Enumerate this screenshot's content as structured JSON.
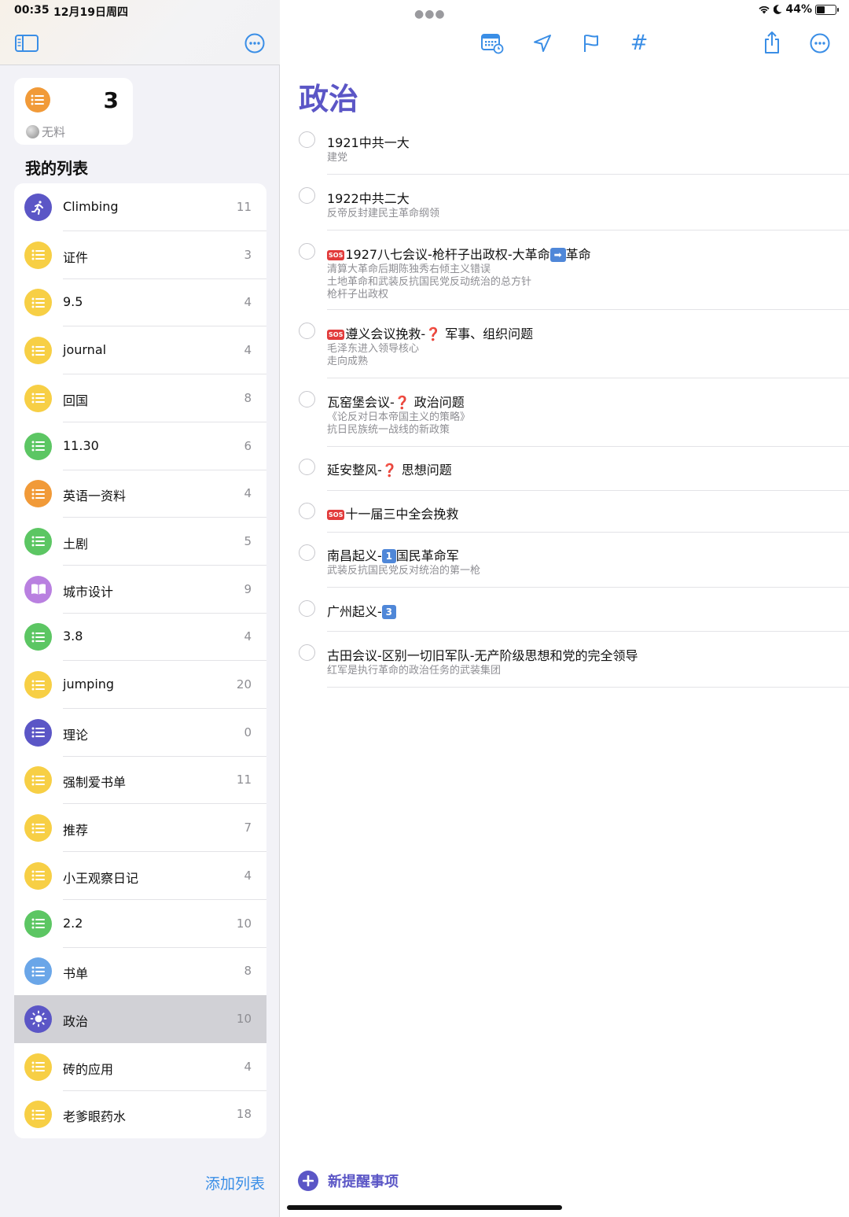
{
  "status": {
    "time": "00:35",
    "date": "12月19日周四",
    "battery": "44%",
    "battery_level": 0.44
  },
  "smart_card": {
    "count": "3",
    "label": "无料"
  },
  "my_lists_title": "我的列表",
  "lists": [
    {
      "name": "Climbing",
      "count": "11",
      "color": "#5b56c6",
      "icon": "running-person-icon"
    },
    {
      "name": "证件",
      "count": "3",
      "color": "#f7cf45",
      "icon": "list-icon"
    },
    {
      "name": "9.5",
      "count": "4",
      "color": "#f7cf45",
      "icon": "list-icon"
    },
    {
      "name": "journal",
      "count": "4",
      "color": "#f7cf45",
      "icon": "list-icon"
    },
    {
      "name": "回国",
      "count": "8",
      "color": "#f7cf45",
      "icon": "list-icon"
    },
    {
      "name": "11.30",
      "count": "6",
      "color": "#5cc663",
      "icon": "list-icon"
    },
    {
      "name": "英语一资料",
      "count": "4",
      "color": "#f19a38",
      "icon": "list-icon"
    },
    {
      "name": "土剧",
      "count": "5",
      "color": "#5cc663",
      "icon": "list-icon"
    },
    {
      "name": "城市设计",
      "count": "9",
      "color": "#b980e0",
      "icon": "book-icon"
    },
    {
      "name": "3.8",
      "count": "4",
      "color": "#5cc663",
      "icon": "list-icon"
    },
    {
      "name": "jumping",
      "count": "20",
      "color": "#f7cf45",
      "icon": "list-icon"
    },
    {
      "name": "理论",
      "count": "0",
      "color": "#5b56c6",
      "icon": "list-icon"
    },
    {
      "name": "强制爱书单",
      "count": "11",
      "color": "#f7cf45",
      "icon": "list-icon"
    },
    {
      "name": "推荐",
      "count": "7",
      "color": "#f7cf45",
      "icon": "list-icon"
    },
    {
      "name": "小王观察日记",
      "count": "4",
      "color": "#f7cf45",
      "icon": "list-icon"
    },
    {
      "name": "2.2",
      "count": "10",
      "color": "#5cc663",
      "icon": "list-icon"
    },
    {
      "name": "书单",
      "count": "8",
      "color": "#6aa6e8",
      "icon": "list-icon"
    },
    {
      "name": "政治",
      "count": "10",
      "color": "#5b56c6",
      "icon": "sun-icon",
      "selected": true
    },
    {
      "name": "砖的应用",
      "count": "4",
      "color": "#f7cf45",
      "icon": "list-icon"
    },
    {
      "name": "老爹眼药水",
      "count": "18",
      "color": "#f7cf45",
      "icon": "list-icon"
    }
  ],
  "add_list_label": "添加列表",
  "main": {
    "title": "政治",
    "reminders": [
      {
        "title": "1921中共一大",
        "notes": [
          "建党"
        ]
      },
      {
        "title": "1922中共二大",
        "notes": [
          "反帝反封建民主革命纲领"
        ]
      },
      {
        "sos": true,
        "title_parts": [
          "1927八七会议-枪杆子出政权-大革命",
          "革命"
        ],
        "arrow": "➡",
        "notes": [
          "清算大革命后期陈独秀右倾主义错误",
          "土地革命和武装反抗国民党反动统治的总方针",
          "枪杆子出政权"
        ]
      },
      {
        "sos": true,
        "title_parts": [
          "遵义会议挽救-",
          "军事、组织问题"
        ],
        "qmark": "❓",
        "notes": [
          "毛泽东进入领导核心",
          "走向成熟"
        ]
      },
      {
        "title_parts": [
          "瓦窑堡会议-",
          "政治问题"
        ],
        "qmark": "❓",
        "notes": [
          "《论反对日本帝国主义的策略》",
          "抗日民族统一战线的新政策"
        ]
      },
      {
        "title_parts": [
          "延安整风-",
          "思想问题"
        ],
        "qmark": "❓",
        "notes": []
      },
      {
        "sos": true,
        "title": "十一届三中全会挽救",
        "notes": []
      },
      {
        "title_parts": [
          "南昌起义-",
          "国民革命军"
        ],
        "num": "1",
        "notes": [
          "武装反抗国民党反对统治的第一枪"
        ]
      },
      {
        "title_parts": [
          "广州起义-",
          ""
        ],
        "num": "3",
        "notes": []
      },
      {
        "title": "古田会议-区别一切旧军队-无产阶级思想和党的完全领导",
        "notes": [
          "红军是执行革命的政治任务的武装集团"
        ]
      }
    ],
    "new_reminder_label": "新提醒事项",
    "sos_label": "SOS"
  }
}
